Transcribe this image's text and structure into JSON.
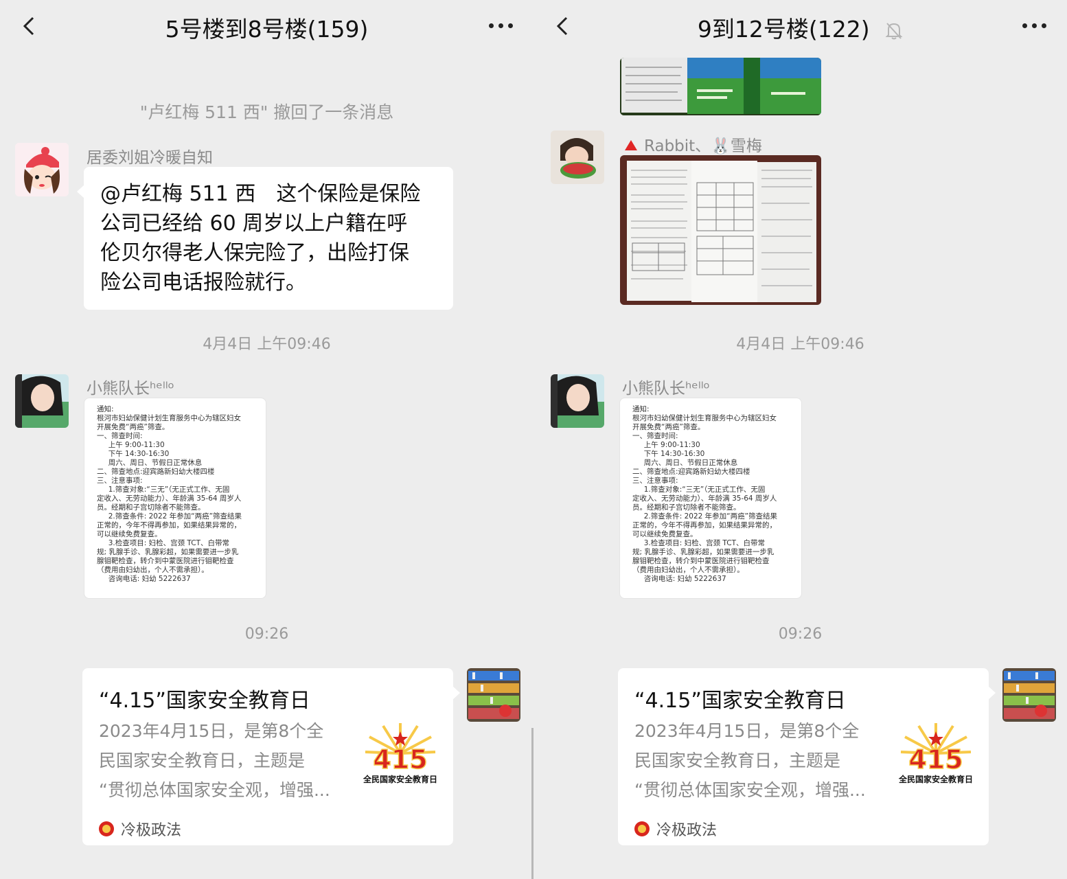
{
  "left": {
    "header": {
      "title": "5号楼到8号楼(159)"
    },
    "system_notice": "\"卢红梅 511 西\" 撤回了一条消息",
    "messages": [
      {
        "sender": "居委刘姐冷暖自知",
        "lines": [
          "@卢红梅 511 西　这个保险是保险",
          "公司已经给 60 周岁以上户籍在呼",
          "伦贝尔得老人保完险了，出险打保",
          "险公司电话报险就行。"
        ]
      }
    ],
    "time1": "4月4日 上午09:46",
    "notice_sender": "小熊队长ʰᵉˡˡᵒ",
    "time2": "09:26"
  },
  "right": {
    "header": {
      "title": "9到12号楼(122)"
    },
    "group_label": "Rabbit、🐰雪梅",
    "time1": "4月4日 上午09:46",
    "notice_sender": "小熊队长ʰᵉˡˡᵒ",
    "time2": "09:26"
  },
  "notice_text": "通知:\n根河市妇幼保健计划生育服务中心为辖区妇女\n开展免费“两癌”筛查。\n一、筛查时间:\n     上午 9:00-11:30\n     下午 14:30-16:30\n     周六、周日、节假日正常休息\n二、筛查地点:迎宾路新妇幼大楼四楼\n三、注意事项:\n     1.筛查对象:“三无”（无正式工作、无固\n定收入、无劳动能力）、年龄满 35-64 周岁人\n员。经期和子宫切除者不能筛查。\n     2.筛查条件: 2022 年参加“两癌”筛查结果\n正常的，今年不得再参加，如果结果异常的，\n可以继续免费复查。\n     3.检查项目: 妇检、宫颈 TCT、白带常\n规; 乳腺手诊、乳腺彩超，如果需要进一步乳\n腺钼靶检查，转介到中蒙医院进行钼靶检查\n（费用由妇幼出，个人不需承担）。\n     咨询电话: 妇幼 5222637",
  "card": {
    "title": "“4.15”国家安全教育日",
    "desc_lines": [
      "2023年4月15日，是第8个全",
      "民国家安全教育日，主题是",
      "“贯彻总体国家安全观，增强..."
    ],
    "logo_number": "415",
    "logo_text": "全民国家安全教育日",
    "source": "冷极政法"
  },
  "colors": {
    "background": "#ededed",
    "bubble": "#ffffff",
    "meta_text": "#9a9a9a",
    "logo_red": "#d8261d",
    "logo_yellow": "#f7c948"
  },
  "icons": [
    "back-arrow-icon",
    "more-icon",
    "mute-bell-icon",
    "red-triangle-icon",
    "party-emblem-icon"
  ]
}
